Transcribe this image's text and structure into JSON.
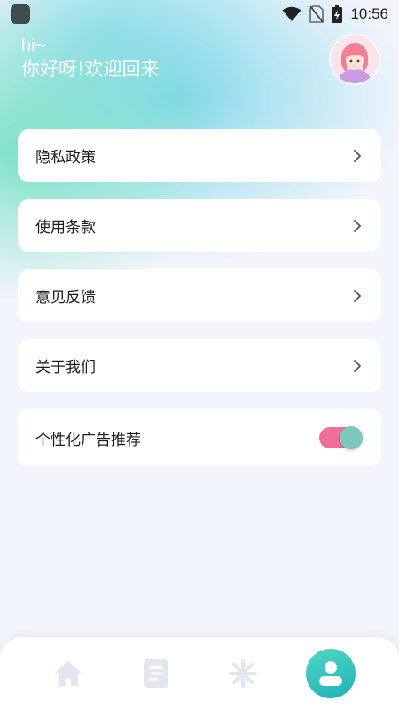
{
  "status_bar": {
    "time": "10:56",
    "icons": [
      "app-icon",
      "wifi-icon",
      "no-sim-icon",
      "battery-charging-icon"
    ]
  },
  "header": {
    "greeting": "hi~",
    "welcome": "你好呀!欢迎回来"
  },
  "avatar": {
    "icon": "avatar-girl-icon"
  },
  "menu": {
    "items": [
      {
        "label": "隐私政策",
        "icon": "chevron-right-icon"
      },
      {
        "label": "使用条款",
        "icon": "chevron-right-icon"
      },
      {
        "label": "意见反馈",
        "icon": "chevron-right-icon"
      },
      {
        "label": "关于我们",
        "icon": "chevron-right-icon"
      }
    ],
    "toggle": {
      "label": "个性化广告推荐",
      "on": true
    }
  },
  "tabbar": {
    "tabs": [
      {
        "icon": "home-icon",
        "active": false
      },
      {
        "icon": "document-icon",
        "active": false
      },
      {
        "icon": "sparkle-icon",
        "active": false
      },
      {
        "icon": "user-icon",
        "active": true
      }
    ]
  },
  "colors": {
    "toggle_track": "#f06f98",
    "toggle_knob": "#7cc8bd",
    "active_tab": "#2cc3bd",
    "inactive_tab": "#e3e6ee"
  }
}
